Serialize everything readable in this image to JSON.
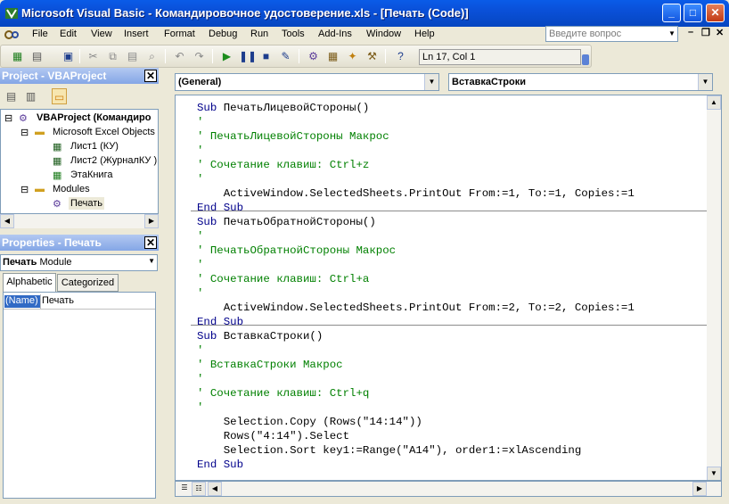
{
  "window": {
    "title": "Microsoft Visual Basic - Командировочное удостоверение.xls - [Печать (Code)]"
  },
  "menu": [
    "File",
    "Edit",
    "View",
    "Insert",
    "Format",
    "Debug",
    "Run",
    "Tools",
    "Add-Ins",
    "Window",
    "Help"
  ],
  "ask": {
    "placeholder": "Введите вопрос"
  },
  "toolbar": {
    "position": "Ln 17, Col 1"
  },
  "project": {
    "header": "Project - VBAProject",
    "tree": {
      "root": "VBAProject (Командиро",
      "excel_objects": "Microsoft Excel Objects",
      "sheet1": "Лист1 (КУ)",
      "sheet2": "Лист2 (ЖурналКУ )",
      "workbook": "ЭтаКнига",
      "modules": "Modules",
      "module1": "Печать"
    }
  },
  "properties": {
    "header": "Properties - Печать",
    "object_name": "Печать",
    "object_type": "Module",
    "tabs": [
      "Alphabetic",
      "Categorized"
    ],
    "row": {
      "name": "(Name)",
      "value": "Печать"
    }
  },
  "code": {
    "object_combo": "(General)",
    "proc_combo": "ВставкаСтроки",
    "lines": [
      {
        "kind": "kw",
        "text": "Sub ПечатьЛицевойСтороны()"
      },
      {
        "kind": "cm",
        "text": "'"
      },
      {
        "kind": "cm",
        "text": "' ПечатьЛицевойСтороны Макрос"
      },
      {
        "kind": "cm",
        "text": "'"
      },
      {
        "kind": "cm",
        "text": "' Сочетание клавиш: Ctrl+z"
      },
      {
        "kind": "cm",
        "text": "'"
      },
      {
        "kind": "tx",
        "text": "    ActiveWindow.SelectedSheets.PrintOut From:=1, To:=1, Copies:=1"
      },
      {
        "kind": "kw",
        "text": "End Sub"
      },
      {
        "kind": "kw",
        "text": "Sub ПечатьОбратнойСтороны()"
      },
      {
        "kind": "cm",
        "text": "'"
      },
      {
        "kind": "cm",
        "text": "' ПечатьОбратнойСтороны Макрос"
      },
      {
        "kind": "cm",
        "text": "'"
      },
      {
        "kind": "cm",
        "text": "' Сочетание клавиш: Ctrl+a"
      },
      {
        "kind": "cm",
        "text": "'"
      },
      {
        "kind": "tx",
        "text": "    ActiveWindow.SelectedSheets.PrintOut From:=2, To:=2, Copies:=1"
      },
      {
        "kind": "kw",
        "text": "End Sub"
      },
      {
        "kind": "kw",
        "text": "Sub ВставкаСтроки()"
      },
      {
        "kind": "cm",
        "text": "'"
      },
      {
        "kind": "cm",
        "text": "' ВставкаСтроки Макрос"
      },
      {
        "kind": "cm",
        "text": "'"
      },
      {
        "kind": "cm",
        "text": "' Сочетание клавиш: Ctrl+q"
      },
      {
        "kind": "cm",
        "text": "'"
      },
      {
        "kind": "tx",
        "text": "    Selection.Copy (Rows(\"14:14\"))"
      },
      {
        "kind": "tx",
        "text": "    Rows(\"4:14\").Select"
      },
      {
        "kind": "tx",
        "text": "    Selection.Sort key1:=Range(\"A14\"), order1:=xlAscending"
      },
      {
        "kind": "kw",
        "text": "End Sub"
      }
    ]
  }
}
